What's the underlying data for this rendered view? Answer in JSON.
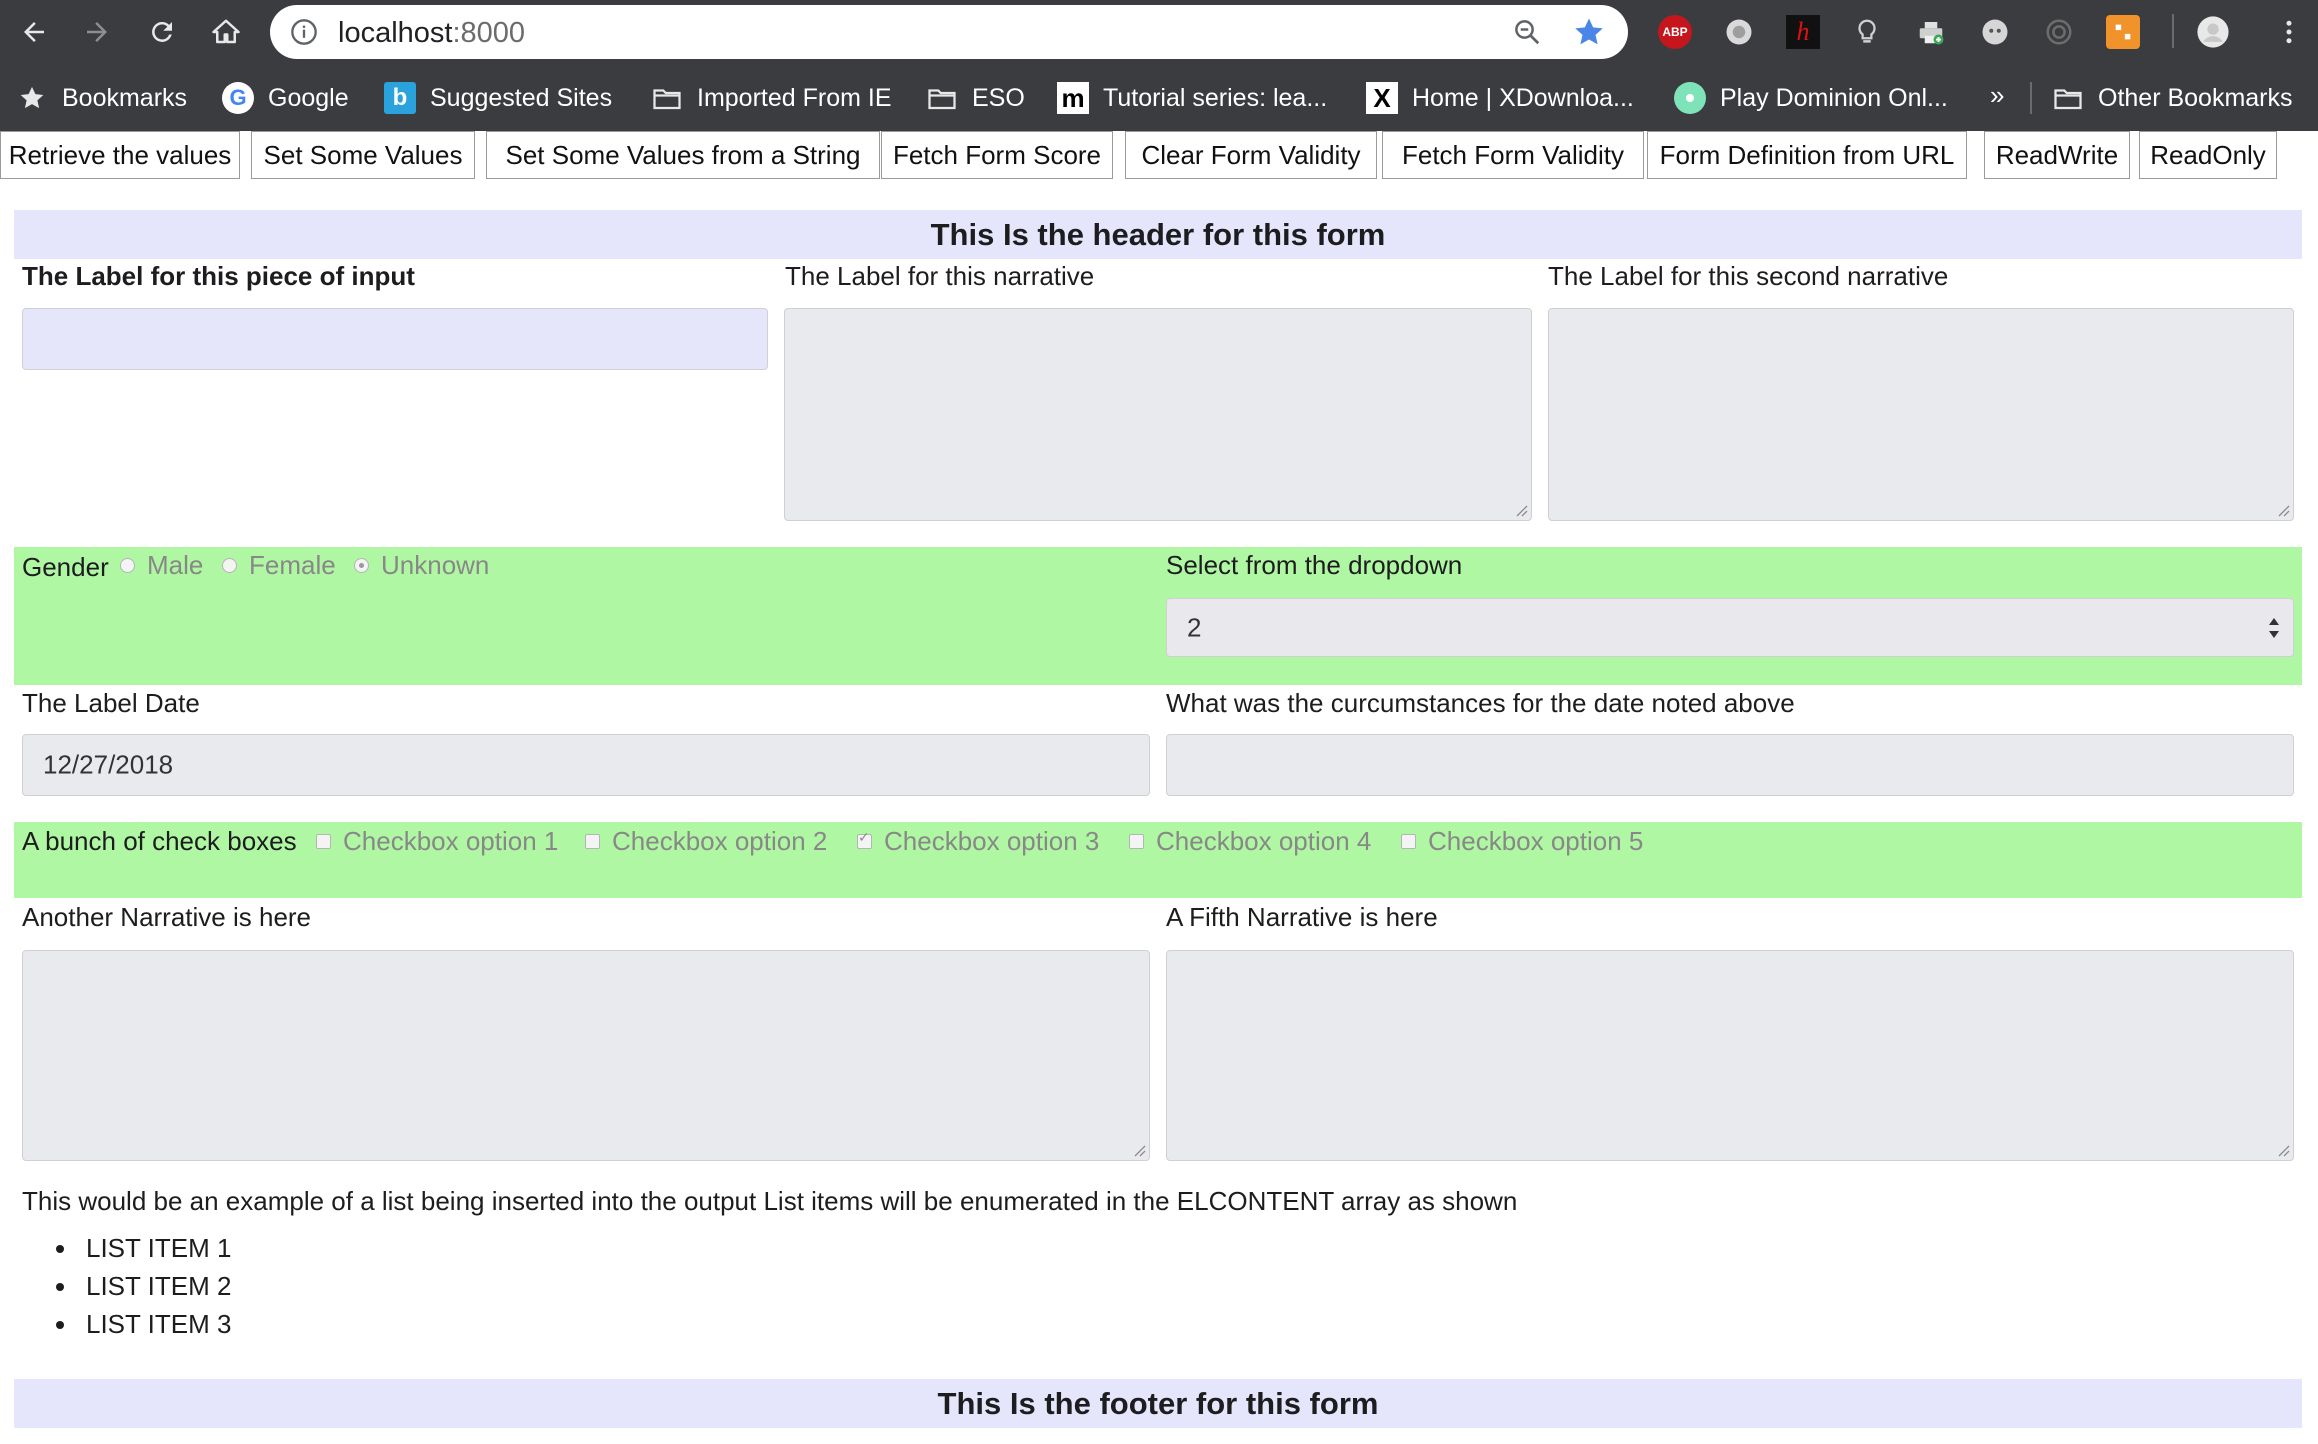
{
  "browser": {
    "url_host": "localhost",
    "url_port": ":8000",
    "bookmarks": [
      {
        "label": "Bookmarks",
        "icon": "star-icon"
      },
      {
        "label": "Google",
        "icon": "google-icon"
      },
      {
        "label": "Suggested Sites",
        "icon": "bing-icon"
      },
      {
        "label": "Imported From IE",
        "icon": "folder-icon"
      },
      {
        "label": "ESO",
        "icon": "folder-icon"
      },
      {
        "label": "Tutorial series: lea...",
        "icon": "m-icon"
      },
      {
        "label": "Home | XDownloa...",
        "icon": "x-icon"
      },
      {
        "label": "Play Dominion Onl...",
        "icon": "dominion-icon"
      }
    ],
    "more_label": "»",
    "other_bookmarks": "Other Bookmarks",
    "extensions": {
      "abp": "ABP",
      "h": "h"
    }
  },
  "buttons": [
    "Retrieve the values",
    "Set Some Values",
    "Set Some Values from a String",
    "Fetch Form Score",
    "Clear Form Validity",
    "Fetch Form Validity",
    "Form Definition from URL",
    "ReadWrite",
    "ReadOnly"
  ],
  "form": {
    "header": "This Is the header for this form",
    "input_label": "The Label for this piece of input",
    "input_value": "",
    "narrative_label": "The Label for this narrative",
    "narrative2_label": "The Label for this second narrative",
    "gender": {
      "label": "Gender",
      "options": [
        "Male",
        "Female",
        "Unknown"
      ],
      "selected": "Unknown"
    },
    "dropdown": {
      "label": "Select from the dropdown",
      "value": "2"
    },
    "date": {
      "label": "The Label Date",
      "value": "12/27/2018"
    },
    "circumstances_label": "What was the curcumstances for the date noted above",
    "checkboxes": {
      "label": "A bunch of check boxes",
      "options": [
        "Checkbox option 1",
        "Checkbox option 2",
        "Checkbox option 3",
        "Checkbox option 4",
        "Checkbox option 5"
      ],
      "checked": [
        "Checkbox option 3"
      ]
    },
    "narrative4_label": "Another Narrative is here",
    "narrative5_label": "A Fifth Narrative is here",
    "list_intro": "This would be an example of a list being inserted into the output List items will be enumerated in the ELCONTENT array as shown",
    "list_items": [
      "LIST ITEM 1",
      "LIST ITEM 2",
      "LIST ITEM 3"
    ],
    "footer": "This Is the footer for this form"
  },
  "colors": {
    "chrome": "#3b3c3f",
    "band": "#e5e5fb",
    "green_section": "#b0f7a3",
    "field": "#e8eaed",
    "input_lavender": "#e6e6fa",
    "star_accent": "#4a86e8"
  }
}
